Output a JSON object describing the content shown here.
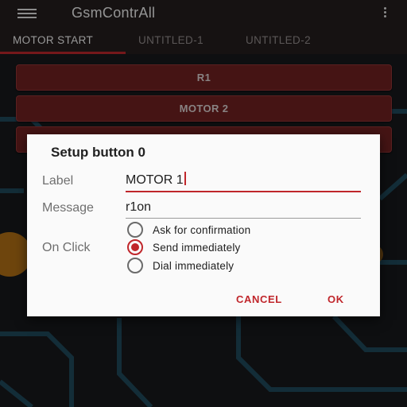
{
  "app": {
    "title": "GsmContrAll",
    "menu_icon": "hamburger-menu-icon",
    "overflow_icon": "more-vert-icon"
  },
  "tabs": [
    {
      "label": "MOTOR START",
      "active": true
    },
    {
      "label": "UNTITLED-1",
      "active": false
    },
    {
      "label": "UNTITLED-2",
      "active": false
    }
  ],
  "buttons": [
    {
      "label": "R1"
    },
    {
      "label": "MOTOR 2"
    },
    {
      "label": ""
    }
  ],
  "dialog": {
    "title": "Setup button 0",
    "label_field": {
      "label": "Label",
      "value": "MOTOR 1"
    },
    "message_field": {
      "label": "Message",
      "value": "r1on"
    },
    "on_click": {
      "label": "On Click",
      "options": [
        {
          "label": "Ask for confirmation",
          "selected": false
        },
        {
          "label": "Send immediately",
          "selected": true
        },
        {
          "label": "Dial immediately",
          "selected": false
        }
      ]
    },
    "cancel_label": "CANCEL",
    "ok_label": "OK"
  },
  "colors": {
    "accent": "#c0262b",
    "app_bar": "#221c1c",
    "button_bg": "#6a1f20",
    "circuit": "#1f4a5e"
  }
}
